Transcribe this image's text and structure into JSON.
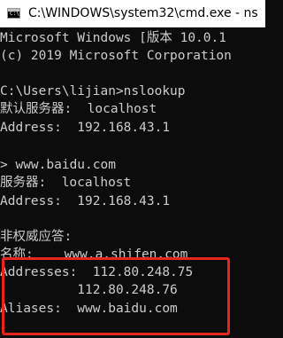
{
  "window": {
    "title": "C:\\WINDOWS\\system32\\cmd.exe - ns",
    "icon": "cmd-console-icon",
    "icon_glyph": "C:\\"
  },
  "console": {
    "lines": [
      "Microsoft Windows [版本 10.0.1",
      "(c) 2019 Microsoft Corporation",
      "",
      "C:\\Users\\lijian>nslookup",
      "默认服务器:  localhost",
      "Address:  192.168.43.1",
      "",
      "> www.baidu.com",
      "服务器:  localhost",
      "Address:  192.168.43.1",
      "",
      "非权威应答:",
      "名称:    www.a.shifen.com",
      "Addresses:  112.80.248.75",
      "          112.80.248.76",
      "Aliases:  www.baidu.com"
    ]
  },
  "colors": {
    "background": "#0c0c0c",
    "text": "#cccccc",
    "highlight": "#e8261e"
  }
}
